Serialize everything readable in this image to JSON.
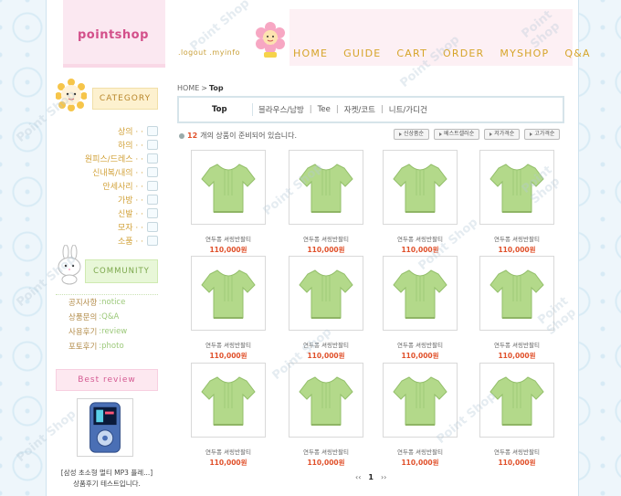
{
  "header": {
    "logo": "pointshop",
    "login_links": ".logout .myinfo",
    "nav": [
      "HOME",
      "GUIDE",
      "CART",
      "ORDER",
      "MYSHOP",
      "Q&A"
    ]
  },
  "sidebar": {
    "category_title": "CATEGORY",
    "categories": [
      "상의 · ·",
      "하의 · ·",
      "원피스/드레스 · ·",
      "신내복/내의 · ·",
      "안세사리 · ·",
      "가방 · ·",
      "신발 · ·",
      "모자 · ·",
      "소품 · ·"
    ],
    "community_title": "COMMUNITY",
    "community": [
      {
        "ko": "공지사항",
        "en": ":notice"
      },
      {
        "ko": "상품문의",
        "en": ":Q&A"
      },
      {
        "ko": "사용후기",
        "en": ":review"
      },
      {
        "ko": "포토후기",
        "en": ":photo"
      }
    ],
    "best_review_title": "Best review",
    "best_review_item": "[삼성 초소형 멀티 MP3 플레...]",
    "best_review_text": "상품후기 테스트입니다."
  },
  "breadcrumb": {
    "home": "HOME",
    "sep": ">",
    "current": "Top"
  },
  "subcategories": {
    "active": "Top",
    "items": [
      "블라우스/남방",
      "Tee",
      "자켓/코트",
      "니트/가디건"
    ],
    "separator": "|"
  },
  "listing": {
    "count": "12",
    "count_text": "개의 상품이 준비되어 있습니다.",
    "sort_buttons": [
      "신상품순",
      "베스트셀러순",
      "저가격순",
      "고가격순"
    ]
  },
  "products": [
    {
      "name": "연두퐁 셔링반팔티",
      "price": "110,000원"
    },
    {
      "name": "연두퐁 셔링반팔티",
      "price": "110,000원"
    },
    {
      "name": "연두퐁 셔링반팔티",
      "price": "110,000원"
    },
    {
      "name": "연두퐁 셔링반팔티",
      "price": "110,000원"
    },
    {
      "name": "연두퐁 셔링반팔티",
      "price": "110,000원"
    },
    {
      "name": "연두퐁 셔링반팔티",
      "price": "110,000원"
    },
    {
      "name": "연두퐁 셔링반팔티",
      "price": "110,000원"
    },
    {
      "name": "연두퐁 셔링반팔티",
      "price": "110,000원"
    },
    {
      "name": "연두퐁 셔링반팔티",
      "price": "110,000원"
    },
    {
      "name": "연두퐁 셔링반팔티",
      "price": "110,000원"
    },
    {
      "name": "연두퐁 셔링반팔티",
      "price": "110,000원"
    },
    {
      "name": "연두퐁 셔링반팔티",
      "price": "110,000원"
    }
  ],
  "pagination": {
    "prev": "‹‹",
    "current": "1",
    "next": "››"
  },
  "watermark": "Point Shop",
  "colors": {
    "accent": "#e0502a",
    "nav": "#d6a52a",
    "logo": "#d34f8a",
    "shirt": "#b3d98a"
  }
}
